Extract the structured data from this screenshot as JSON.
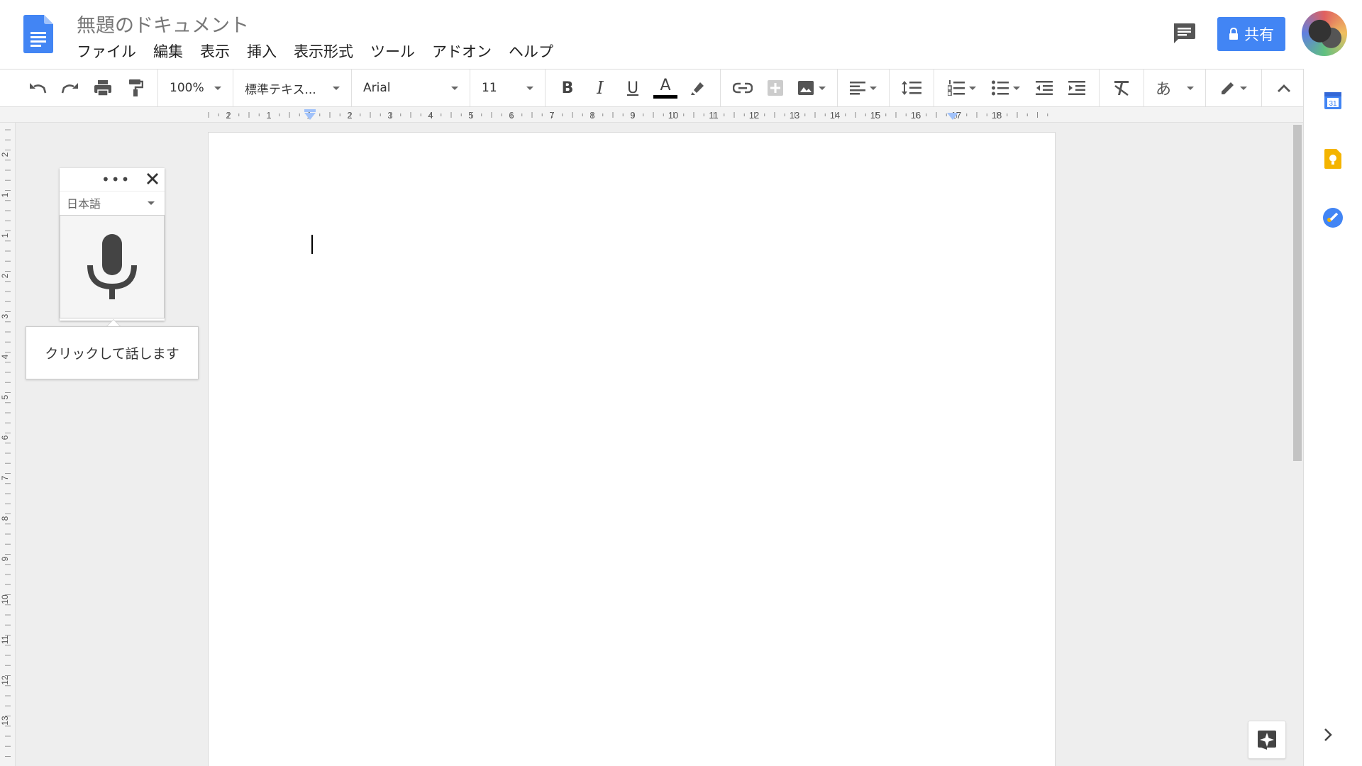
{
  "app": {
    "title": "無題のドキュメント",
    "menus": [
      "ファイル",
      "編集",
      "表示",
      "挿入",
      "表示形式",
      "ツール",
      "アドオン",
      "ヘルプ"
    ],
    "share_label": "共有"
  },
  "toolbar": {
    "zoom": "100%",
    "style": "標準テキス...",
    "font": "Arial",
    "font_size": "11",
    "bold": "B",
    "italic": "I",
    "underline": "U",
    "text_color_glyph": "A",
    "input_tools_glyph": "あ"
  },
  "ruler": {
    "horizontal": [
      "2",
      "1",
      "1",
      "2",
      "3",
      "4",
      "5",
      "6",
      "7",
      "8",
      "9",
      "10",
      "11",
      "12",
      "13",
      "14",
      "15",
      "16",
      "17",
      "18"
    ],
    "vertical": [
      "2",
      "1",
      "1",
      "2",
      "3",
      "4",
      "5",
      "6",
      "7",
      "8",
      "9",
      "10",
      "11",
      "12",
      "13"
    ]
  },
  "voice_typing": {
    "language": "日本語",
    "hint": "クリックして話します",
    "menu_glyph": "•••"
  },
  "side_panel": {
    "calendar_day": "31"
  },
  "colors": {
    "brand_blue": "#4285f4",
    "keep_yellow": "#f4b400",
    "text_color_bar": "#000000"
  }
}
